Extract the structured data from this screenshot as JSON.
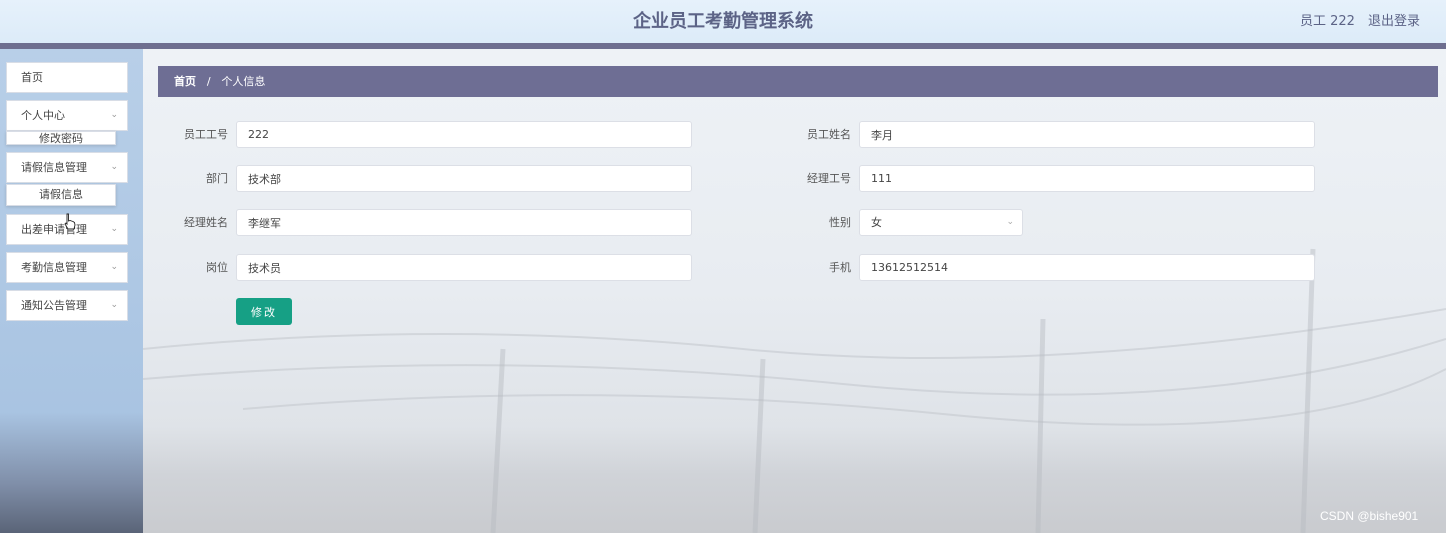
{
  "header": {
    "title": "企业员工考勤管理系统",
    "user": "员工 222",
    "logout": "退出登录"
  },
  "sidebar": {
    "items": [
      {
        "label": "首页"
      },
      {
        "label": "个人中心"
      },
      {
        "label": "修改密码"
      },
      {
        "label": "请假信息管理"
      },
      {
        "label": "请假信息"
      },
      {
        "label": "出差申请管理"
      },
      {
        "label": "考勤信息管理"
      },
      {
        "label": "通知公告管理"
      }
    ],
    "chevron": "chevron-down-icon"
  },
  "breadcrumb": {
    "home": "首页",
    "separator": "/",
    "current": "个人信息"
  },
  "form": {
    "fields": [
      {
        "label": "员工工号",
        "value": "222"
      },
      {
        "label": "员工姓名",
        "value": "李月"
      },
      {
        "label": "部门",
        "value": "技术部"
      },
      {
        "label": "经理工号",
        "value": "111"
      },
      {
        "label": "经理姓名",
        "value": "李继军"
      },
      {
        "label": "性别",
        "value": "女"
      },
      {
        "label": "岗位",
        "value": "技术员"
      },
      {
        "label": "手机",
        "value": "13612512514"
      }
    ],
    "submit_label": "修改"
  },
  "watermark": "CSDN @bishe901",
  "colors": {
    "header_bar": "#6e6e8f",
    "breadcrumb_bg": "#6e6e94",
    "button_bg": "#16a085",
    "title_color": "#5c6386"
  }
}
